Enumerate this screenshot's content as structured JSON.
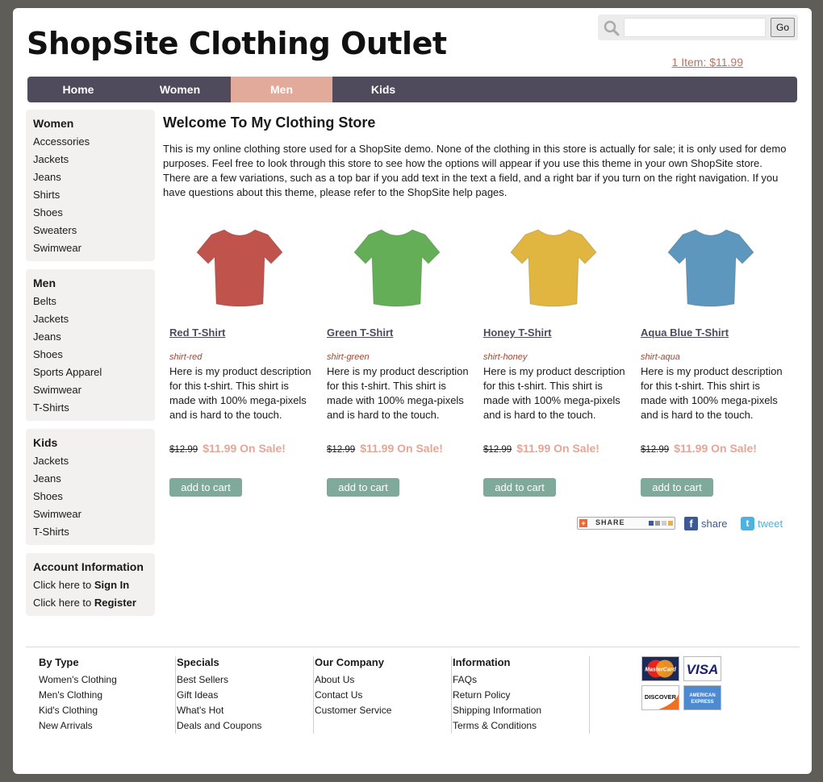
{
  "site": {
    "title": "ShopSite Clothing Outlet"
  },
  "search": {
    "placeholder": "",
    "go_label": "Go"
  },
  "cart": {
    "summary": "1 Item: $11.99"
  },
  "topnav": {
    "tabs": [
      {
        "label": "Home",
        "active": false
      },
      {
        "label": "Women",
        "active": false
      },
      {
        "label": "Men",
        "active": true
      },
      {
        "label": "Kids",
        "active": false
      }
    ]
  },
  "sidebar": {
    "women": {
      "heading": "Women",
      "items": [
        "Accessories",
        "Jackets",
        "Jeans",
        "Shirts",
        "Shoes",
        "Sweaters",
        "Swimwear"
      ]
    },
    "men": {
      "heading": "Men",
      "items": [
        "Belts",
        "Jackets",
        "Jeans",
        "Shoes",
        "Sports Apparel",
        "Swimwear",
        "T-Shirts"
      ]
    },
    "kids": {
      "heading": "Kids",
      "items": [
        "Jackets",
        "Jeans",
        "Shoes",
        "Swimwear",
        "T-Shirts"
      ]
    },
    "account": {
      "heading": "Account Information",
      "signin_prefix": "Click here to ",
      "signin_link": "Sign In",
      "register_prefix": "Click here to ",
      "register_link": "Register"
    }
  },
  "main": {
    "heading": "Welcome To My Clothing Store",
    "intro": "This is my online clothing store used for a ShopSite demo. None of the clothing in this store is actually for sale; it is only used for demo purposes. Feel free to look through this store to see how the options will appear if you use this theme in your own ShopSite store. There are a few variations, such as a top bar if you add text in the text a field, and a right bar if you turn on the right navigation. If you have questions about this theme, please refer to the ShopSite help pages."
  },
  "products": [
    {
      "name": "Red T-Shirt",
      "sku": "shirt-red",
      "color": "#c0534c",
      "desc": "Here is my product description for this t-shirt. This shirt is made with 100% mega-pixels and is hard to the touch.",
      "old_price": "$12.99",
      "sale_price": "$11.99 On Sale!",
      "cart_label": "add to cart"
    },
    {
      "name": "Green T-Shirt",
      "sku": "shirt-green",
      "color": "#63ae57",
      "desc": "Here is my product description for this t-shirt. This shirt is made with 100% mega-pixels and is hard to the touch.",
      "old_price": "$12.99",
      "sale_price": "$11.99 On Sale!",
      "cart_label": "add to cart"
    },
    {
      "name": "Honey T-Shirt",
      "sku": "shirt-honey",
      "color": "#e0b640",
      "desc": "Here is my product description for this t-shirt. This shirt is made with 100% mega-pixels and is hard to the touch.",
      "old_price": "$12.99",
      "sale_price": "$11.99 On Sale!",
      "cart_label": "add to cart"
    },
    {
      "name": "Aqua Blue T-Shirt",
      "sku": "shirt-aqua",
      "color": "#5d97bd",
      "desc": "Here is my product description for this t-shirt. This shirt is made with 100% mega-pixels and is hard to the touch.",
      "old_price": "$12.99",
      "sale_price": "$11.99 On Sale!",
      "cart_label": "add to cart"
    }
  ],
  "share": {
    "share_label": "SHARE",
    "facebook_label": "share",
    "twitter_label": "tweet"
  },
  "footer": {
    "columns": [
      {
        "heading": "By Type",
        "items": [
          "Women's Clothing",
          "Men's Clothing",
          "Kid's Clothing",
          "New Arrivals"
        ]
      },
      {
        "heading": "Specials",
        "items": [
          "Best Sellers",
          "Gift Ideas",
          "What's Hot",
          "Deals and Coupons"
        ]
      },
      {
        "heading": "Our Company",
        "items": [
          "About Us",
          "Contact Us",
          "Customer Service"
        ]
      },
      {
        "heading": "Information",
        "items": [
          "FAQs",
          "Return Policy",
          "Shipping Information",
          "Terms & Conditions"
        ]
      }
    ],
    "cards": {
      "mastercard": "MasterCard",
      "visa": "VISA",
      "discover": "DISCOVER",
      "amex_line1": "AMERICAN",
      "amex_line2": "EXPRESS"
    }
  },
  "colors": {
    "nav_bar": "#4f4b5c",
    "nav_active": "#e1aa9b",
    "cart_button": "#7ea99b",
    "sale_price": "#e3a697",
    "link": "#c66f57"
  }
}
